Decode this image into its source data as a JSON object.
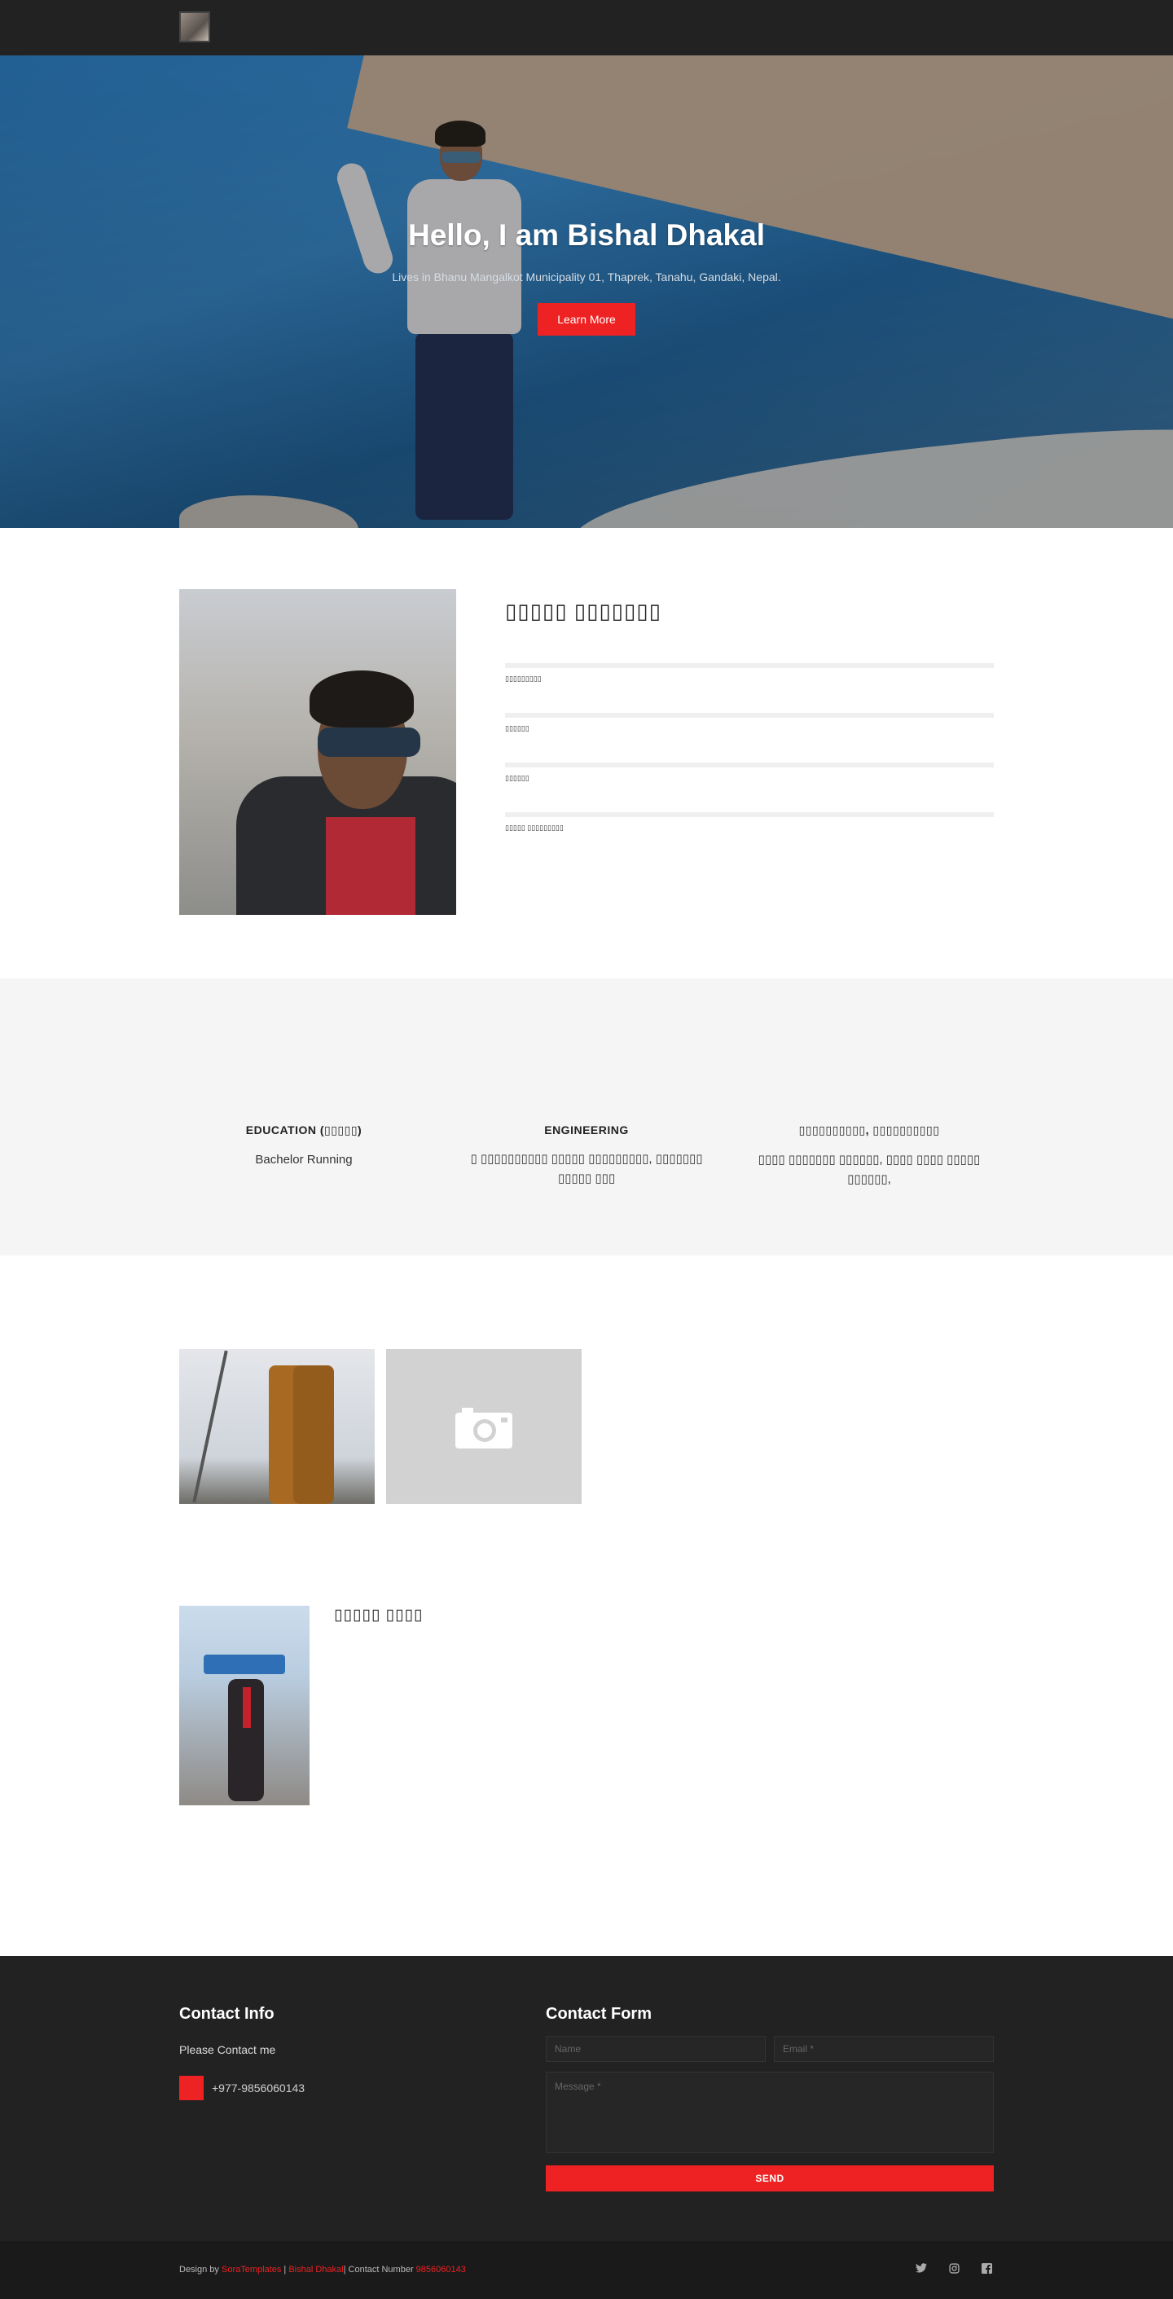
{
  "hero": {
    "title": "Hello, I am Bishal Dhakal",
    "subtitle": "Lives in Bhanu Mangalkot Municipality 01, Thaprek, Tanahu, Gandaki, Nepal.",
    "button_label": "Learn More"
  },
  "about": {
    "title": "▯▯▯▯▯ ▯▯▯▯▯▯▯",
    "skills": [
      {
        "label": "▯▯▯▯▯▯▯▯▯",
        "progress": 0
      },
      {
        "label": "▯▯▯▯▯▯",
        "progress": 0
      },
      {
        "label": "▯▯▯▯▯▯",
        "progress": 0
      },
      {
        "label": "▯▯▯▯▯ ▯▯▯▯▯▯▯▯▯",
        "progress": 0
      }
    ]
  },
  "features": [
    {
      "title": "EDUCATION (▯▯▯▯▯)",
      "text": "Bachelor Running"
    },
    {
      "title": "ENGINEERING",
      "text": "▯ ▯▯▯▯▯▯▯▯▯▯ ▯▯▯▯▯ ▯▯▯▯▯▯▯▯▯, ▯▯▯▯▯▯▯ ▯▯▯▯▯ ▯▯▯"
    },
    {
      "title": "▯▯▯▯▯▯▯▯▯▯, ▯▯▯▯▯▯▯▯▯▯",
      "text": "▯▯▯▯ ▯▯▯▯▯▯▯ ▯▯▯▯▯▯, ▯▯▯▯ ▯▯▯▯ ▯▯▯▯▯ ▯▯▯▯▯▯,"
    }
  ],
  "blog": {
    "title": "▯▯▯▯▯ ▯▯▯▯"
  },
  "contact": {
    "info_title": "Contact Info",
    "info_text": "Please Contact me",
    "phone": "+977-9856060143",
    "form_title": "Contact Form",
    "name_placeholder": "Name",
    "email_placeholder": "Email *",
    "message_placeholder": "Message *",
    "send_label": "SEND"
  },
  "footer": {
    "design_by": "Design by ",
    "sora": "SoraTemplates",
    "sep1": " | ",
    "author": "Bishal Dhakal",
    "sep2": "| Contact Number ",
    "number": "9856060143",
    "social": [
      "twitter-icon",
      "instagram-icon",
      "facebook-icon"
    ]
  },
  "colors": {
    "accent": "#ee2222",
    "dark": "#222222",
    "footer": "#1a1a1a"
  }
}
